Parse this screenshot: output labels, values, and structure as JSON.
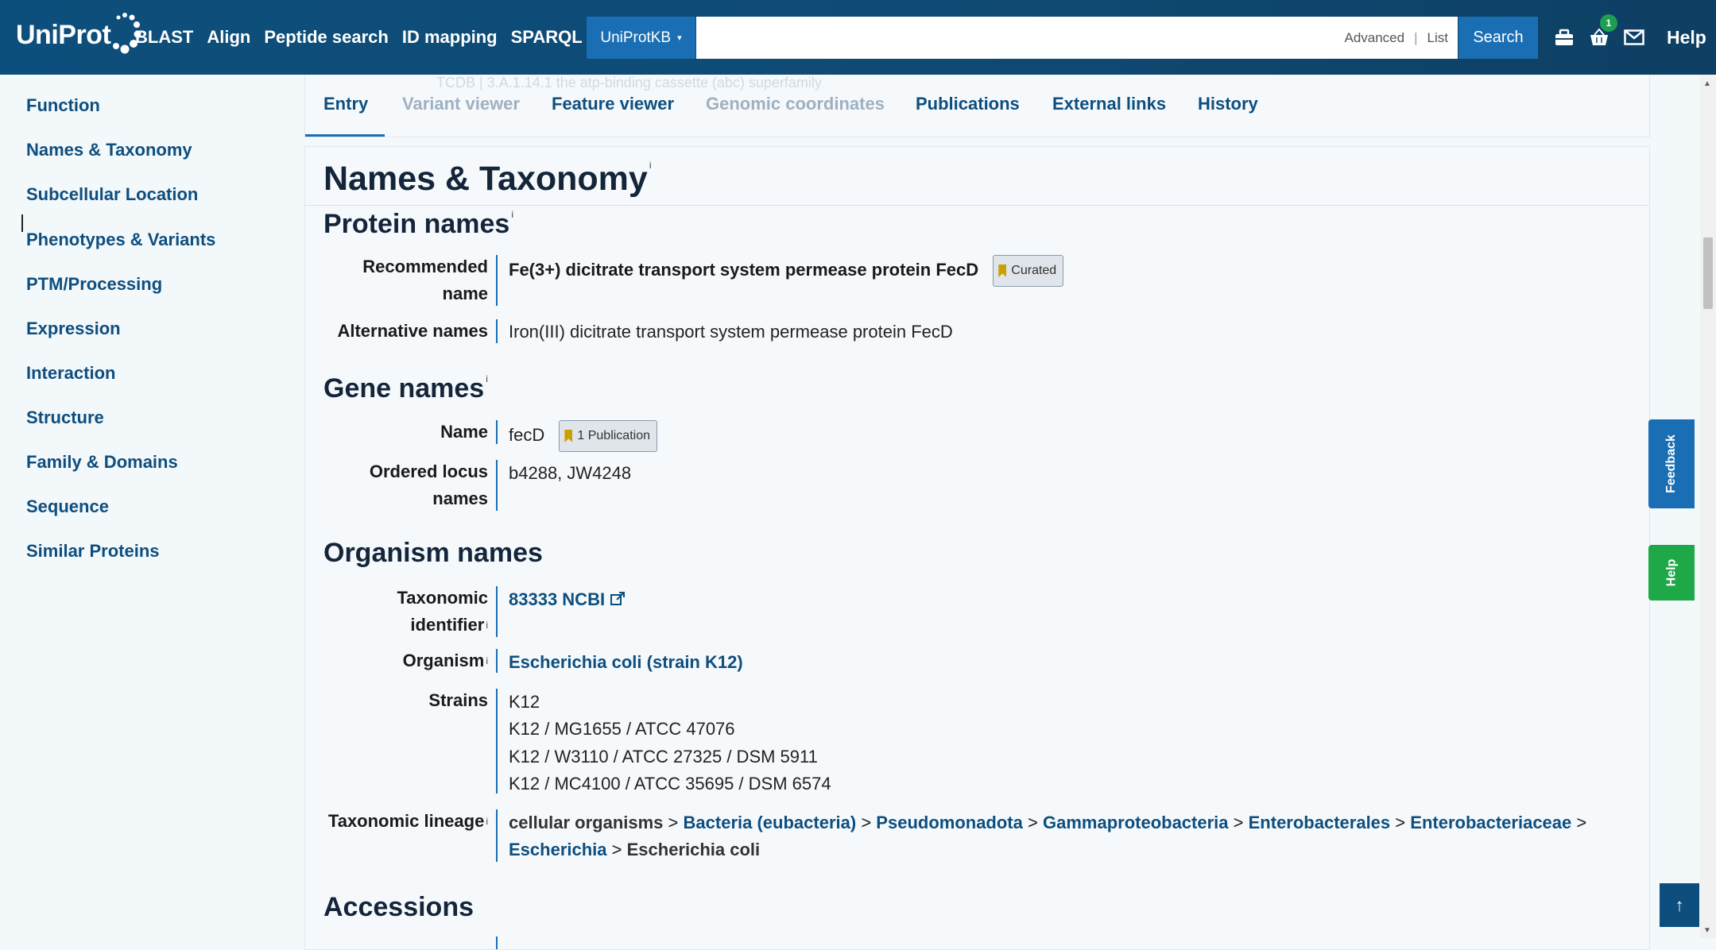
{
  "header": {
    "logo_text": "UniProt",
    "nav": [
      "BLAST",
      "Align",
      "Peptide search",
      "ID mapping",
      "SPARQL"
    ],
    "db_selector": "UniProtKB",
    "search_placeholder": "",
    "advanced_label": "Advanced",
    "list_label": "List",
    "search_button": "Search",
    "basket_count": "1",
    "help_label": "Help"
  },
  "sidebar": {
    "items": [
      "Function",
      "Names & Taxonomy",
      "Subcellular Location",
      "Phenotypes & Variants",
      "PTM/Processing",
      "Expression",
      "Interaction",
      "Structure",
      "Family & Domains",
      "Sequence",
      "Similar Proteins"
    ]
  },
  "tabs": {
    "faded_text": "TCDB  |  3.A.1.14.1  the atp-binding cassette (abc) superfamily",
    "items": [
      "Entry",
      "Variant viewer",
      "Feature viewer",
      "Genomic coordinates",
      "Publications",
      "External links",
      "History"
    ]
  },
  "section": {
    "title": "Names & Taxonomy",
    "info": "i",
    "protein_names": {
      "heading": "Protein names",
      "recommended_label": "Recommended name",
      "recommended_value": "Fe(3+) dicitrate transport system permease protein FecD",
      "recommended_badge": "Curated",
      "alternative_label": "Alternative names",
      "alternative_value": "Iron(III) dicitrate transport system permease protein FecD"
    },
    "gene_names": {
      "heading": "Gene names",
      "name_label": "Name",
      "name_value": "fecD",
      "name_badge": "1 Publication",
      "locus_label": "Ordered locus names",
      "locus_value": "b4288, JW4248"
    },
    "organism_names": {
      "heading": "Organism names",
      "taxid_label": "Taxonomic identifier",
      "taxid_value": "83333 NCBI",
      "organism_label": "Organism",
      "organism_value": "Escherichia coli (strain K12)",
      "strains_label": "Strains",
      "strains": [
        "K12",
        "K12 / MG1655 / ATCC 47076",
        "K12 / W3110 / ATCC 27325 / DSM 5911",
        "K12 / MC4100 / ATCC 35695 / DSM 6574"
      ],
      "lineage_label": "Taxonomic lineage",
      "lineage": {
        "l0": "cellular organisms",
        "l1": "Bacteria (eubacteria)",
        "l2": "Pseudomonadota",
        "l3": "Gammaproteobacteria",
        "l4": "Enterobacterales",
        "l5": "Enterobacteriaceae",
        "l6": "Escherichia",
        "l7": "Escherichia coli",
        "sep": ">"
      }
    },
    "accessions_heading": "Accessions"
  },
  "side_tabs": {
    "feedback": "Feedback",
    "help": "Help",
    "back_to_top": "↑"
  },
  "colors": {
    "header_bg": "#0f4a74",
    "accent": "#1a6fb4",
    "link": "#0e4e7e",
    "help_green": "#1fa848"
  }
}
